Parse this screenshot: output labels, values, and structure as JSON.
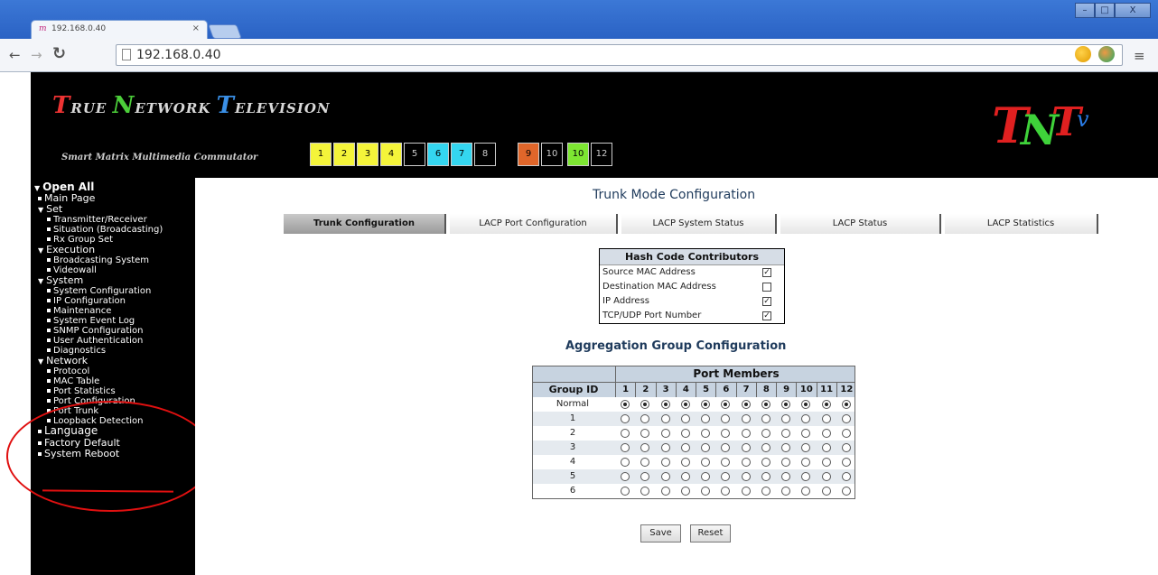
{
  "browser": {
    "tab_title": "192.168.0.40",
    "tab_favicon": "m",
    "tab_close": "×",
    "url": "192.168.0.40",
    "window_controls": [
      "–",
      "□",
      "X"
    ]
  },
  "banner": {
    "brand_words": [
      {
        "cap": "T",
        "rest": "RUE"
      },
      {
        "cap": "N",
        "rest": "ETWORK"
      },
      {
        "cap": "T",
        "rest": "ELEVISION"
      }
    ],
    "tagline": "Smart Matrix Multimedia Commutator",
    "ports": [
      {
        "label": "1",
        "color": "#f4f43a"
      },
      {
        "label": "2",
        "color": "#f4f43a"
      },
      {
        "label": "3",
        "color": "#f4f43a"
      },
      {
        "label": "4",
        "color": "#f4f43a"
      },
      {
        "label": "5",
        "color": "#000000"
      },
      {
        "label": "6",
        "color": "#34d6f0"
      },
      {
        "label": "7",
        "color": "#34d6f0"
      },
      {
        "label": "8",
        "color": "#000000"
      },
      {
        "label": "9",
        "color": "#e0662a"
      },
      {
        "label": "10",
        "color": "#000000"
      },
      {
        "label": "10",
        "color": "#7de632"
      },
      {
        "label": "12",
        "color": "#000000"
      }
    ],
    "logo": "TNTv"
  },
  "sidebar": {
    "items": [
      {
        "label": "Open All",
        "type": "root"
      },
      {
        "label": "Main Page",
        "type": "leaf"
      },
      {
        "label": "Set",
        "type": "group"
      },
      {
        "label": "Transmitter/Receiver",
        "type": "sub"
      },
      {
        "label": "Situation (Broadcasting)",
        "type": "sub"
      },
      {
        "label": "Rx Group Set",
        "type": "sub"
      },
      {
        "label": "Execution",
        "type": "group"
      },
      {
        "label": "Broadcasting System",
        "type": "sub"
      },
      {
        "label": "Videowall",
        "type": "sub"
      },
      {
        "label": "System",
        "type": "group"
      },
      {
        "label": "System Configuration",
        "type": "sub"
      },
      {
        "label": "IP Configuration",
        "type": "sub"
      },
      {
        "label": "Maintenance",
        "type": "sub"
      },
      {
        "label": "System Event Log",
        "type": "sub"
      },
      {
        "label": "SNMP Configuration",
        "type": "sub"
      },
      {
        "label": "User Authentication",
        "type": "sub"
      },
      {
        "label": "Diagnostics",
        "type": "sub"
      },
      {
        "label": "Network",
        "type": "group"
      },
      {
        "label": "Protocol",
        "type": "sub"
      },
      {
        "label": "MAC Table",
        "type": "sub"
      },
      {
        "label": "Port Statistics",
        "type": "sub"
      },
      {
        "label": "Port Configuration",
        "type": "sub"
      },
      {
        "label": "Port Trunk",
        "type": "sub"
      },
      {
        "label": "Loopback Detection",
        "type": "sub"
      },
      {
        "label": "Language",
        "type": "leaf-l"
      },
      {
        "label": "Factory Default",
        "type": "leaf"
      },
      {
        "label": "System Reboot",
        "type": "leaf"
      }
    ]
  },
  "main": {
    "title": "Trunk Mode Configuration",
    "tabs": [
      {
        "label": "Trunk Configuration",
        "active": true
      },
      {
        "label": "LACP Port Configuration",
        "active": false
      },
      {
        "label": "LACP System Status",
        "active": false
      },
      {
        "label": "LACP Status",
        "active": false
      },
      {
        "label": "LACP Statistics",
        "active": false
      }
    ],
    "hash": {
      "title": "Hash Code Contributors",
      "rows": [
        {
          "label": "Source MAC Address",
          "checked": true
        },
        {
          "label": "Destination MAC Address",
          "checked": false
        },
        {
          "label": "IP Address",
          "checked": true
        },
        {
          "label": "TCP/UDP Port Number",
          "checked": true
        }
      ]
    },
    "aggregation": {
      "title": "Aggregation Group Configuration",
      "port_members_label": "Port Members",
      "group_id_label": "Group ID",
      "ports": [
        "1",
        "2",
        "3",
        "4",
        "5",
        "6",
        "7",
        "8",
        "9",
        "10",
        "11",
        "12"
      ],
      "groups": [
        "Normal",
        "1",
        "2",
        "3",
        "4",
        "5",
        "6"
      ],
      "selected_group": "Normal"
    },
    "buttons": {
      "save": "Save",
      "reset": "Reset"
    }
  }
}
